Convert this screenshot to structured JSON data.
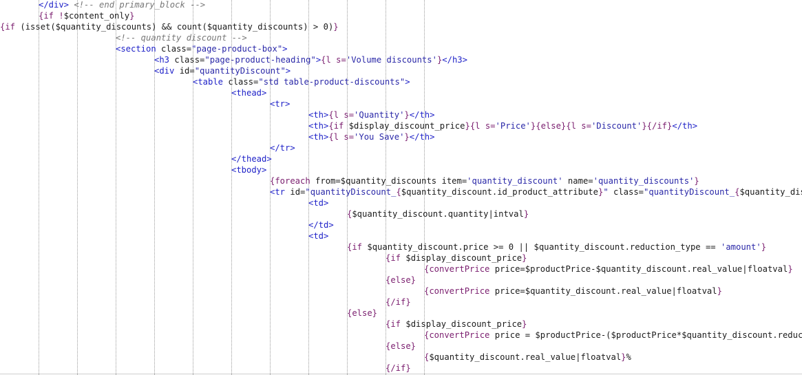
{
  "code_lines": [
    {
      "indent": 1,
      "tokens": [
        [
          "tag",
          "</div>"
        ],
        [
          "plain",
          " "
        ],
        [
          "comment",
          "<!-- end primary_block -->"
        ]
      ]
    },
    {
      "indent": 1,
      "tokens": [
        [
          "smarty",
          "{if !"
        ],
        [
          "plain",
          "$content_only"
        ],
        [
          "smarty",
          "}"
        ]
      ]
    },
    {
      "indent": 0,
      "tokens": [
        [
          "smarty",
          "{if "
        ],
        [
          "plain",
          "(isset($quantity_discounts) && count($quantity_discounts) > 0)"
        ],
        [
          "smarty",
          "}"
        ]
      ]
    },
    {
      "indent": 3,
      "tokens": [
        [
          "comment",
          "<!-- quantity discount -->"
        ]
      ]
    },
    {
      "indent": 3,
      "tokens": [
        [
          "tag",
          "<section "
        ],
        [
          "plain",
          "class="
        ],
        [
          "str",
          "\"page-product-box\""
        ],
        [
          "tag",
          ">"
        ]
      ]
    },
    {
      "indent": 4,
      "tokens": [
        [
          "tag",
          "<h3 "
        ],
        [
          "plain",
          "class="
        ],
        [
          "str",
          "\"page-product-heading\""
        ],
        [
          "tag",
          ">"
        ],
        [
          "smarty",
          "{l s="
        ],
        [
          "str",
          "'Volume discounts'"
        ],
        [
          "smarty",
          "}"
        ],
        [
          "tag",
          "</h3>"
        ]
      ]
    },
    {
      "indent": 4,
      "tokens": [
        [
          "tag",
          "<div "
        ],
        [
          "plain",
          "id="
        ],
        [
          "str",
          "\"quantityDiscount\""
        ],
        [
          "tag",
          ">"
        ]
      ]
    },
    {
      "indent": 5,
      "tokens": [
        [
          "tag",
          "<table "
        ],
        [
          "plain",
          "class="
        ],
        [
          "str",
          "\"std table-product-discounts\""
        ],
        [
          "tag",
          ">"
        ]
      ]
    },
    {
      "indent": 6,
      "tokens": [
        [
          "tag",
          "<thead>"
        ]
      ]
    },
    {
      "indent": 7,
      "tokens": [
        [
          "tag",
          "<tr>"
        ]
      ]
    },
    {
      "indent": 8,
      "tokens": [
        [
          "tag",
          "<th>"
        ],
        [
          "smarty",
          "{l s="
        ],
        [
          "str",
          "'Quantity'"
        ],
        [
          "smarty",
          "}"
        ],
        [
          "tag",
          "</th>"
        ]
      ]
    },
    {
      "indent": 8,
      "tokens": [
        [
          "tag",
          "<th>"
        ],
        [
          "smarty",
          "{if "
        ],
        [
          "plain",
          "$display_discount_price"
        ],
        [
          "smarty",
          "}{l s="
        ],
        [
          "str",
          "'Price'"
        ],
        [
          "smarty",
          "}{else}{l s="
        ],
        [
          "str",
          "'Discount'"
        ],
        [
          "smarty",
          "}{/if}"
        ],
        [
          "tag",
          "</th>"
        ]
      ]
    },
    {
      "indent": 8,
      "tokens": [
        [
          "tag",
          "<th>"
        ],
        [
          "smarty",
          "{l s="
        ],
        [
          "str",
          "'You Save'"
        ],
        [
          "smarty",
          "}"
        ],
        [
          "tag",
          "</th>"
        ]
      ]
    },
    {
      "indent": 7,
      "tokens": [
        [
          "tag",
          "</tr>"
        ]
      ]
    },
    {
      "indent": 6,
      "tokens": [
        [
          "tag",
          "</thead>"
        ]
      ]
    },
    {
      "indent": 6,
      "tokens": [
        [
          "tag",
          "<tbody>"
        ]
      ]
    },
    {
      "indent": 7,
      "tokens": [
        [
          "smarty",
          "{foreach "
        ],
        [
          "plain",
          "from=$quantity_discounts item="
        ],
        [
          "str",
          "'quantity_discount'"
        ],
        [
          "plain",
          " name="
        ],
        [
          "str",
          "'quantity_discounts'"
        ],
        [
          "smarty",
          "}"
        ]
      ]
    },
    {
      "indent": 7,
      "tokens": [
        [
          "tag",
          "<tr "
        ],
        [
          "plain",
          "id="
        ],
        [
          "str",
          "\"quantityDiscount_"
        ],
        [
          "smarty",
          "{"
        ],
        [
          "plain",
          "$quantity_discount.id_product_attribute"
        ],
        [
          "smarty",
          "}"
        ],
        [
          "str",
          "\""
        ],
        [
          "plain",
          " class="
        ],
        [
          "str",
          "\"quantityDiscount_"
        ],
        [
          "smarty",
          "{"
        ],
        [
          "plain",
          "$quantity_discount"
        ]
      ]
    },
    {
      "indent": 8,
      "tokens": [
        [
          "tag",
          "<td>"
        ]
      ]
    },
    {
      "indent": 9,
      "tokens": [
        [
          "smarty",
          "{"
        ],
        [
          "plain",
          "$quantity_discount.quantity|intval"
        ],
        [
          "smarty",
          "}"
        ]
      ]
    },
    {
      "indent": 8,
      "tokens": [
        [
          "tag",
          "</td>"
        ]
      ]
    },
    {
      "indent": 8,
      "tokens": [
        [
          "tag",
          "<td>"
        ]
      ]
    },
    {
      "indent": 9,
      "tokens": [
        [
          "smarty",
          "{if "
        ],
        [
          "plain",
          "$quantity_discount.price >= 0 || $quantity_discount.reduction_type == "
        ],
        [
          "str",
          "'amount'"
        ],
        [
          "smarty",
          "}"
        ]
      ]
    },
    {
      "indent": 10,
      "tokens": [
        [
          "smarty",
          "{if "
        ],
        [
          "plain",
          "$display_discount_price"
        ],
        [
          "smarty",
          "}"
        ]
      ]
    },
    {
      "indent": 11,
      "tokens": [
        [
          "smarty",
          "{convertPrice "
        ],
        [
          "plain",
          "price=$productPrice-$quantity_discount.real_value|floatval"
        ],
        [
          "smarty",
          "}"
        ]
      ]
    },
    {
      "indent": 10,
      "tokens": [
        [
          "smarty",
          "{else}"
        ]
      ]
    },
    {
      "indent": 11,
      "tokens": [
        [
          "smarty",
          "{convertPrice "
        ],
        [
          "plain",
          "price=$quantity_discount.real_value|floatval"
        ],
        [
          "smarty",
          "}"
        ]
      ]
    },
    {
      "indent": 10,
      "tokens": [
        [
          "smarty",
          "{/if}"
        ]
      ]
    },
    {
      "indent": 9,
      "tokens": [
        [
          "smarty",
          "{else}"
        ]
      ]
    },
    {
      "indent": 10,
      "tokens": [
        [
          "smarty",
          "{if "
        ],
        [
          "plain",
          "$display_discount_price"
        ],
        [
          "smarty",
          "}"
        ]
      ]
    },
    {
      "indent": 11,
      "tokens": [
        [
          "smarty",
          "{convertPrice "
        ],
        [
          "plain",
          "price = $productPrice-($productPrice*$quantity_discount.reduction"
        ]
      ]
    },
    {
      "indent": 10,
      "tokens": [
        [
          "smarty",
          "{else}"
        ]
      ]
    },
    {
      "indent": 11,
      "tokens": [
        [
          "smarty",
          "{"
        ],
        [
          "plain",
          "$quantity_discount.real_value|floatval"
        ],
        [
          "smarty",
          "}"
        ],
        [
          "plain",
          "%"
        ]
      ]
    },
    {
      "indent": 10,
      "tokens": [
        [
          "smarty",
          "{/if}"
        ]
      ]
    }
  ]
}
